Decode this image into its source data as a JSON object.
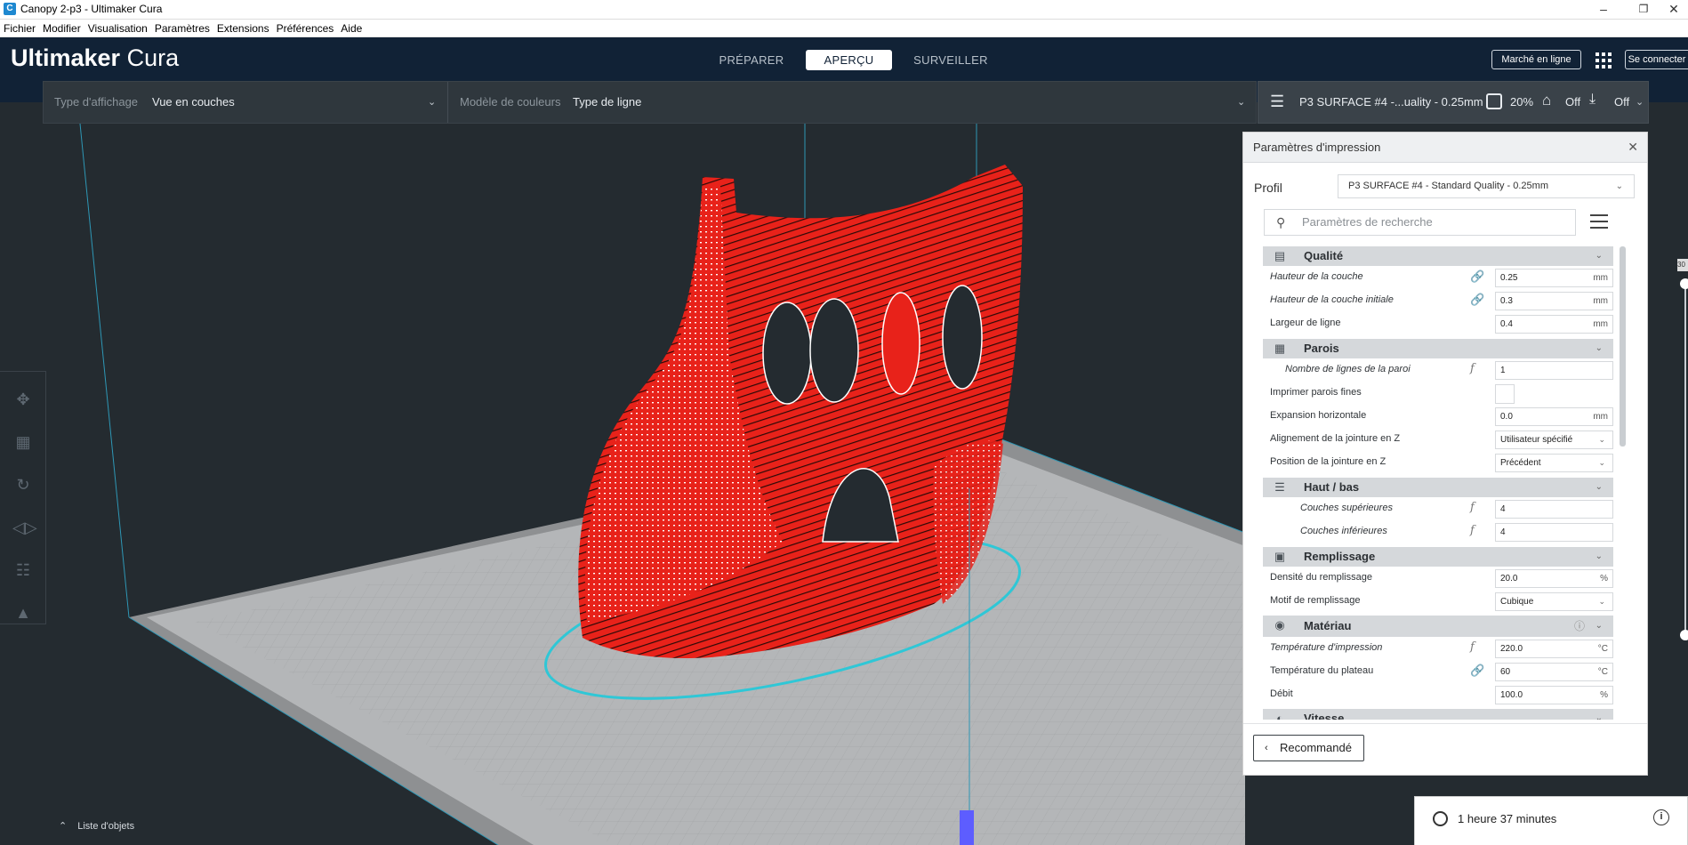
{
  "window": {
    "title": "Canopy 2-p3 - Ultimaker Cura",
    "app_icon": "C"
  },
  "menubar": [
    "Fichier",
    "Modifier",
    "Visualisation",
    "Paramètres",
    "Extensions",
    "Préférences",
    "Aide"
  ],
  "header": {
    "logo_bold": "Ultimaker",
    "logo_light": " Cura",
    "stages": [
      "PRÉPARER",
      "APERÇU",
      "SURVEILLER"
    ],
    "active_stage": "APERÇU",
    "marketplace": "Marché en ligne",
    "signin": "Se connecter"
  },
  "viewbar": {
    "view_type_label": "Type d'affichage",
    "view_type_value": "Vue en couches",
    "color_scheme_label": "Modèle de couleurs",
    "color_scheme_value": "Type de ligne"
  },
  "print_config": {
    "profile_short": "P3 SURFACE #4 -...uality - 0.25mm",
    "infill": "20%",
    "support": "Off",
    "adhesion": "Off"
  },
  "toolbar_icons": [
    "move-icon",
    "scale-icon",
    "rotate-icon",
    "mirror-icon",
    "per-model-settings-icon",
    "support-blocker-icon"
  ],
  "object_list": "Liste d'objets",
  "panel": {
    "title": "Paramètres d'impression",
    "profile_label": "Profil",
    "profile_value": "P3 SURFACE #4 - Standard Quality - 0.25mm",
    "search_placeholder": "Paramètres de recherche",
    "recommended": "Recommandé",
    "categories": {
      "quality": "Qualité",
      "walls": "Parois",
      "topbottom": "Haut / bas",
      "infill": "Remplissage",
      "material": "Matériau",
      "speed": "Vitesse"
    },
    "settings": {
      "layer_height": {
        "label": "Hauteur de la couche",
        "value": "0.25",
        "unit": "mm"
      },
      "initial_layer_height": {
        "label": "Hauteur de la couche initiale",
        "value": "0.3",
        "unit": "mm"
      },
      "line_width": {
        "label": "Largeur de ligne",
        "value": "0.4",
        "unit": "mm"
      },
      "wall_line_count": {
        "label": "Nombre de lignes de la paroi",
        "value": "1"
      },
      "print_thin_walls": {
        "label": "Imprimer parois fines"
      },
      "horizontal_expansion": {
        "label": "Expansion horizontale",
        "value": "0.0",
        "unit": "mm"
      },
      "z_seam_alignment": {
        "label": "Alignement de la jointure en Z",
        "value": "Utilisateur spécifié"
      },
      "z_seam_position": {
        "label": "Position de la jointure en Z",
        "value": "Précédent"
      },
      "top_layers": {
        "label": "Couches supérieures",
        "value": "4"
      },
      "bottom_layers": {
        "label": "Couches inférieures",
        "value": "4"
      },
      "infill_density": {
        "label": "Densité du remplissage",
        "value": "20.0",
        "unit": "%"
      },
      "infill_pattern": {
        "label": "Motif de remplissage",
        "value": "Cubique"
      },
      "print_temperature": {
        "label": "Température d'impression",
        "value": "220.0",
        "unit": "°C"
      },
      "bed_temperature": {
        "label": "Température du plateau",
        "value": "60",
        "unit": "°C"
      },
      "flow": {
        "label": "Débit",
        "value": "100.0",
        "unit": "%"
      }
    }
  },
  "estimate": {
    "time": "1 heure 37 minutes"
  },
  "layer_slider_value": "30",
  "colors": {
    "header": "#112236",
    "viewport": "#242b30",
    "model": "#e8221a",
    "build_plate": "#b4b6b8",
    "outline": "#2fc7d6"
  }
}
